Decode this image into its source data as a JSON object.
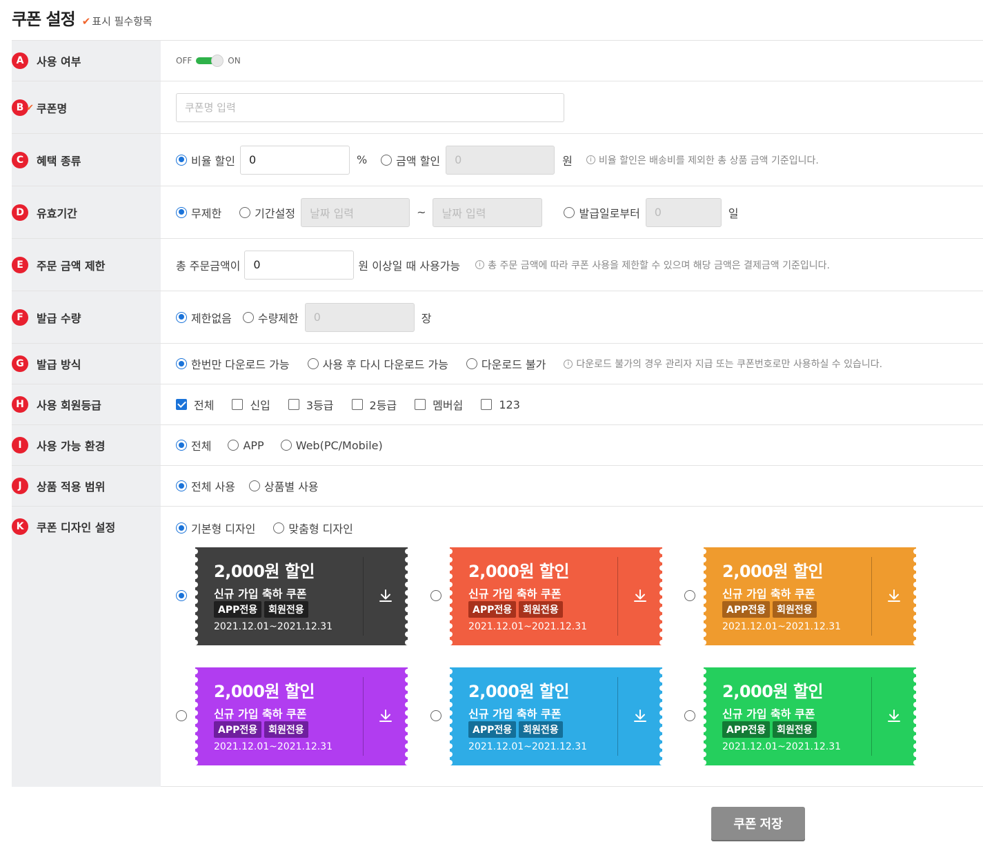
{
  "page": {
    "title": "쿠폰 설정",
    "required_note": "표시 필수항목"
  },
  "rows": {
    "use": {
      "letter": "A",
      "label": "사용 여부",
      "off": "OFF",
      "on": "ON"
    },
    "name": {
      "letter": "B",
      "label": "쿠폰명",
      "placeholder": "쿠폰명 입력"
    },
    "benefit": {
      "letter": "C",
      "label": "혜택 종류",
      "rate_label": "비율 할인",
      "rate_value": "0",
      "rate_unit": "%",
      "amount_label": "금액 할인",
      "amount_value": "0",
      "amount_unit": "원",
      "info": "비율 할인은 배송비를 제외한 총 상품 금액 기준입니다."
    },
    "period": {
      "letter": "D",
      "label": "유효기간",
      "unlimited": "무제한",
      "custom": "기간설정",
      "date_placeholder": "날짜 입력",
      "tilde": "~",
      "from_issue": "발급일로부터",
      "days_value": "0",
      "days_unit": "일"
    },
    "min_amount": {
      "letter": "E",
      "label": "주문 금액 제한",
      "prefix": "총 주문금액이",
      "value": "0",
      "suffix": "원 이상일 때 사용가능",
      "info": "총 주문 금액에 따라 쿠폰 사용을 제한할 수 있으며 해당 금액은 결제금액 기준입니다."
    },
    "quantity": {
      "letter": "F",
      "label": "발급 수량",
      "unlimited": "제한없음",
      "limited": "수량제한",
      "value": "0",
      "unit": "장"
    },
    "method": {
      "letter": "G",
      "label": "발급 방식",
      "once": "한번만 다운로드 가능",
      "again": "사용 후 다시 다운로드 가능",
      "none": "다운로드 불가",
      "info": "다운로드 불가의 경우 관리자 지급 또는 쿠폰번호로만 사용하실 수 있습니다."
    },
    "grade": {
      "letter": "H",
      "label": "사용 회원등급",
      "options": [
        "전체",
        "신입",
        "3등급",
        "2등급",
        "멤버쉽",
        "123"
      ]
    },
    "env": {
      "letter": "I",
      "label": "사용 가능 환경",
      "options": [
        "전체",
        "APP",
        "Web(PC/Mobile)"
      ]
    },
    "scope": {
      "letter": "J",
      "label": "상품 적용 범위",
      "options": [
        "전체 사용",
        "상품별 사용"
      ]
    },
    "design": {
      "letter": "K",
      "label": "쿠폰 디자인 설정",
      "options": [
        "기본형 디자인",
        "맞춤형 디자인"
      ]
    }
  },
  "coupon": {
    "title": "2,000원 할인",
    "subtitle": "신규 가입 축하 쿠폰",
    "tag1": "APP전용",
    "tag2": "회원전용",
    "date": "2021.12.01~2021.12.31"
  },
  "coupon_colors": [
    "#404040",
    "#f15e40",
    "#ef9b2e",
    "#b13df0",
    "#2eace6",
    "#25cf5d"
  ],
  "coupon_tag_colors": [
    "#1f1f1f",
    "#a8321c",
    "#a8621a",
    "#6f1f9e",
    "#146f99",
    "#137a35"
  ],
  "save_button": "쿠폰 저장"
}
